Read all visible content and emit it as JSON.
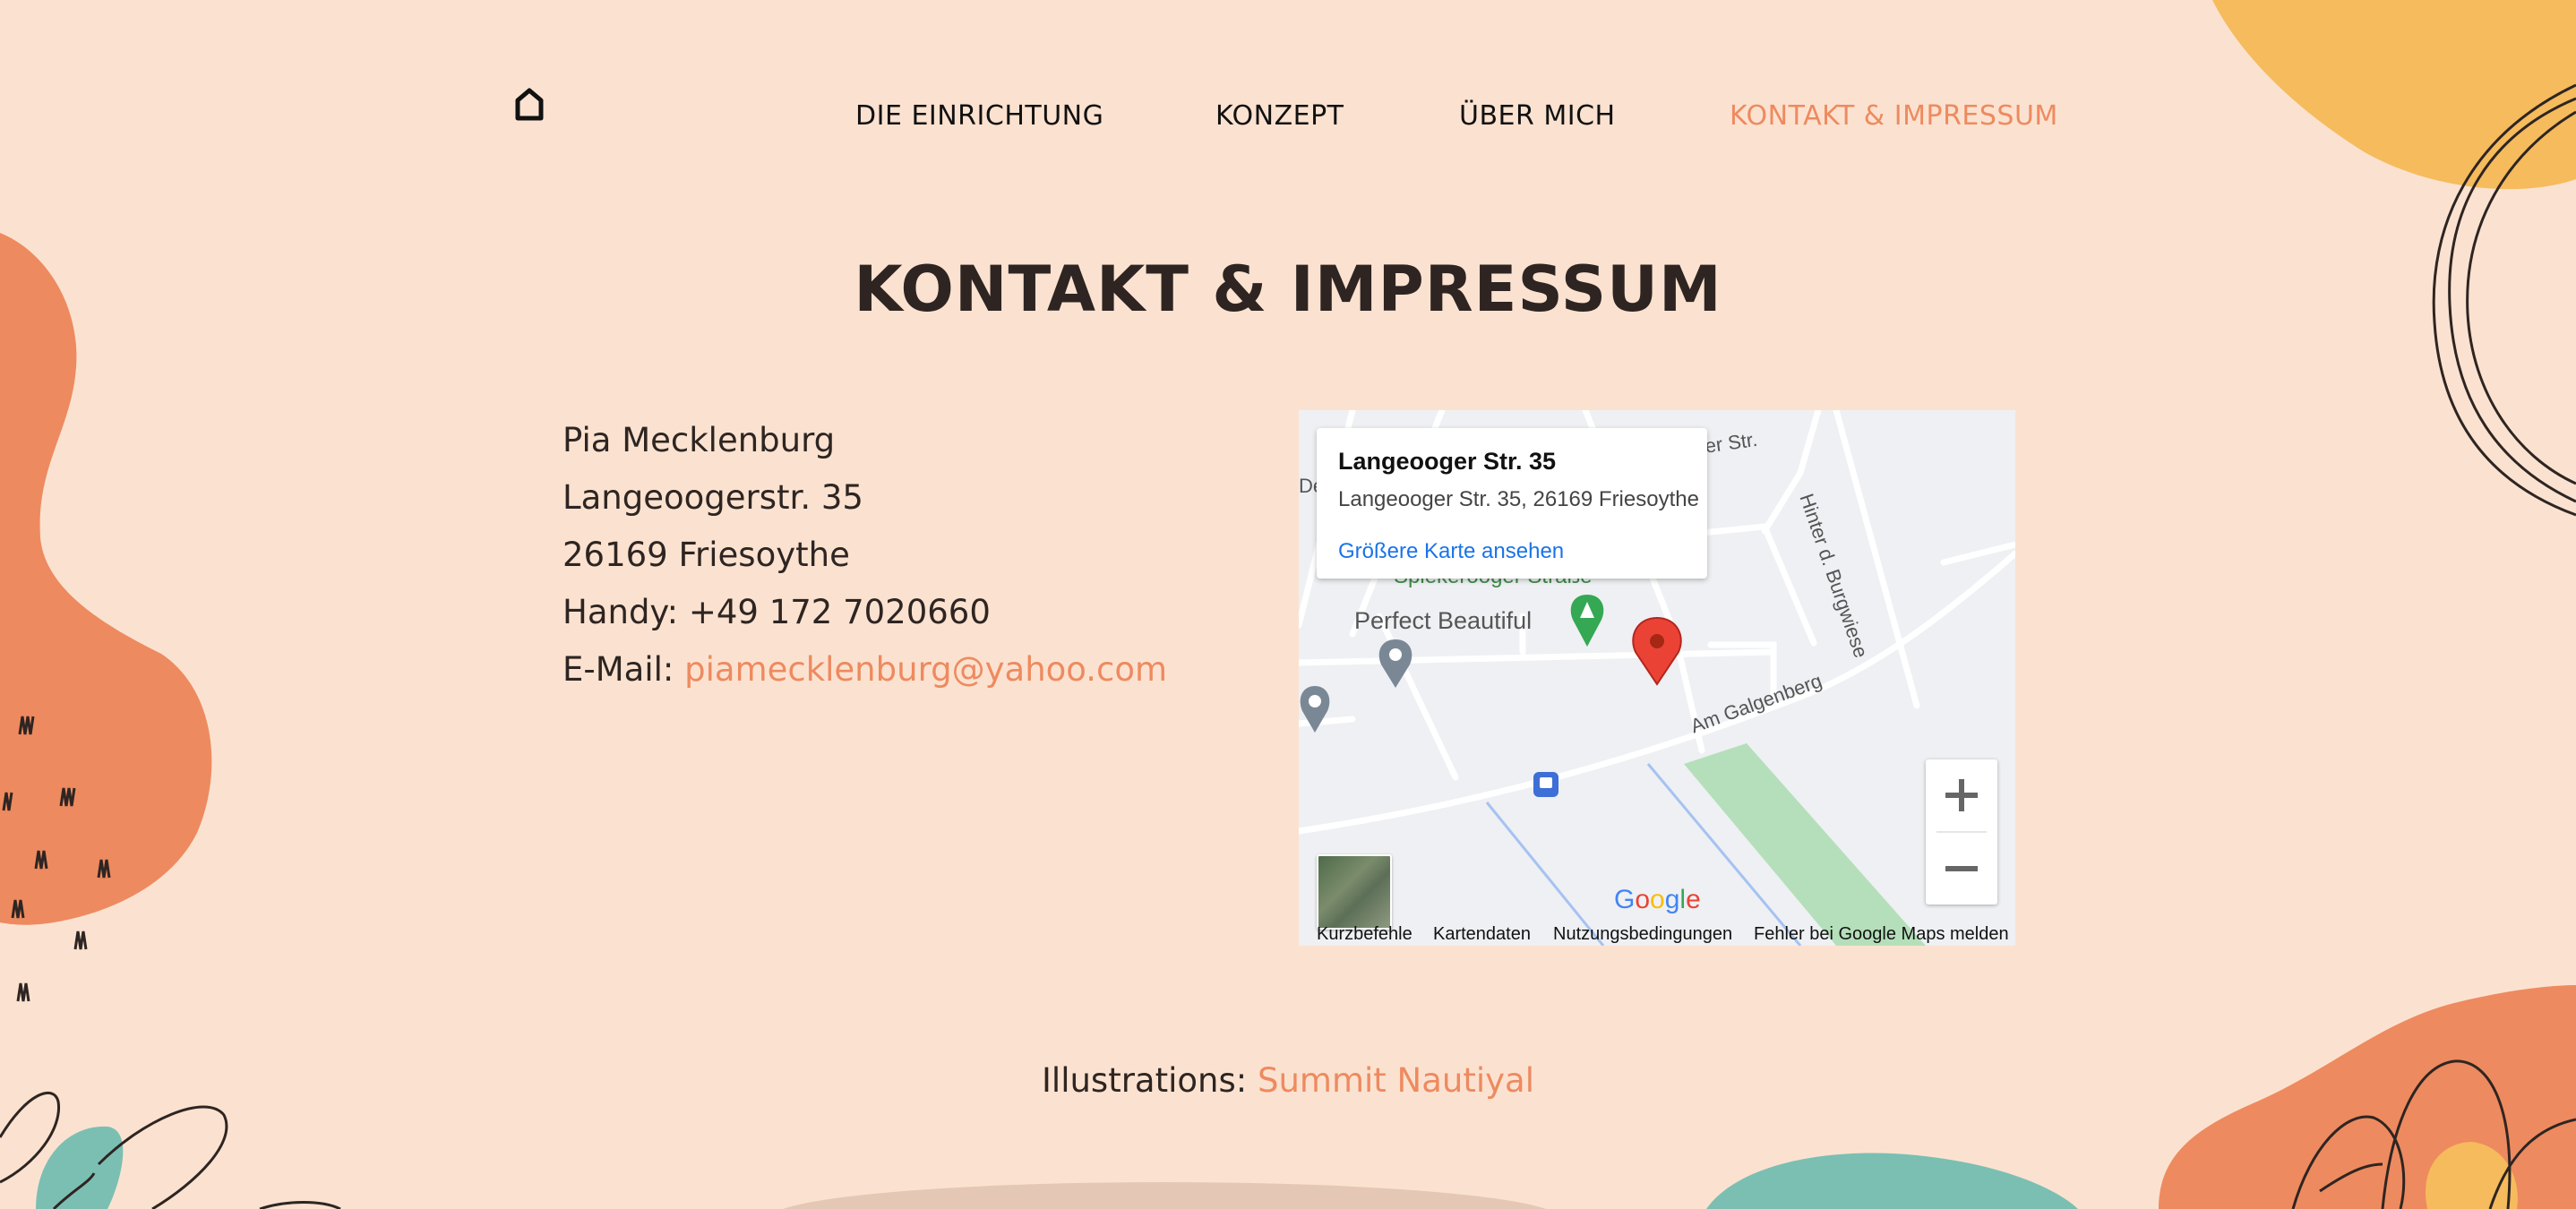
{
  "nav": {
    "home_icon": "home-icon",
    "items": [
      {
        "label": "DIE EINRICHTUNG"
      },
      {
        "label": "KONZEPT"
      },
      {
        "label": "ÜBER MICH"
      },
      {
        "label": "KONTAKT & IMPRESSUM",
        "active": true
      }
    ]
  },
  "page": {
    "title": "KONTAKT & IMPRESSUM"
  },
  "contact": {
    "name": "Pia Mecklenburg",
    "street": "Langeoogerstr. 35",
    "city": "26169 Friesoythe",
    "phone": "Handy: +49 172 7020660",
    "email_label": "E-Mail:",
    "email": "piamecklenburg@yahoo.com"
  },
  "map": {
    "card_title": "Langeooger Str. 35",
    "card_address": "Langeooger Str. 35, 26169 Friesoythe",
    "card_link": "Größere Karte ansehen",
    "labels": {
      "street_1": "Spiekerooger Straße",
      "place": "Perfect Beautiful",
      "street_2": "Am Galgenberg",
      "street_3": "Hinter d. Burgwiese",
      "street_top": "er Str.",
      "street_left": "De"
    },
    "zoom_in": "+",
    "zoom_out": "−",
    "google": "Google",
    "footer": {
      "shortcuts": "Kurzbefehle",
      "data": "Kartendaten",
      "terms": "Nutzungsbedingungen",
      "report": "Fehler bei Google Maps melden"
    }
  },
  "credits": {
    "label": "Illustrations:",
    "author": "Summit Nautiyal"
  },
  "colors": {
    "background": "#fbe2d0",
    "accent": "#ee8a5f",
    "text": "#2e2522",
    "blob_orange": "#ee8a5f",
    "blob_yellow": "#f5bb5c",
    "blob_teal": "#7bbfb3"
  }
}
